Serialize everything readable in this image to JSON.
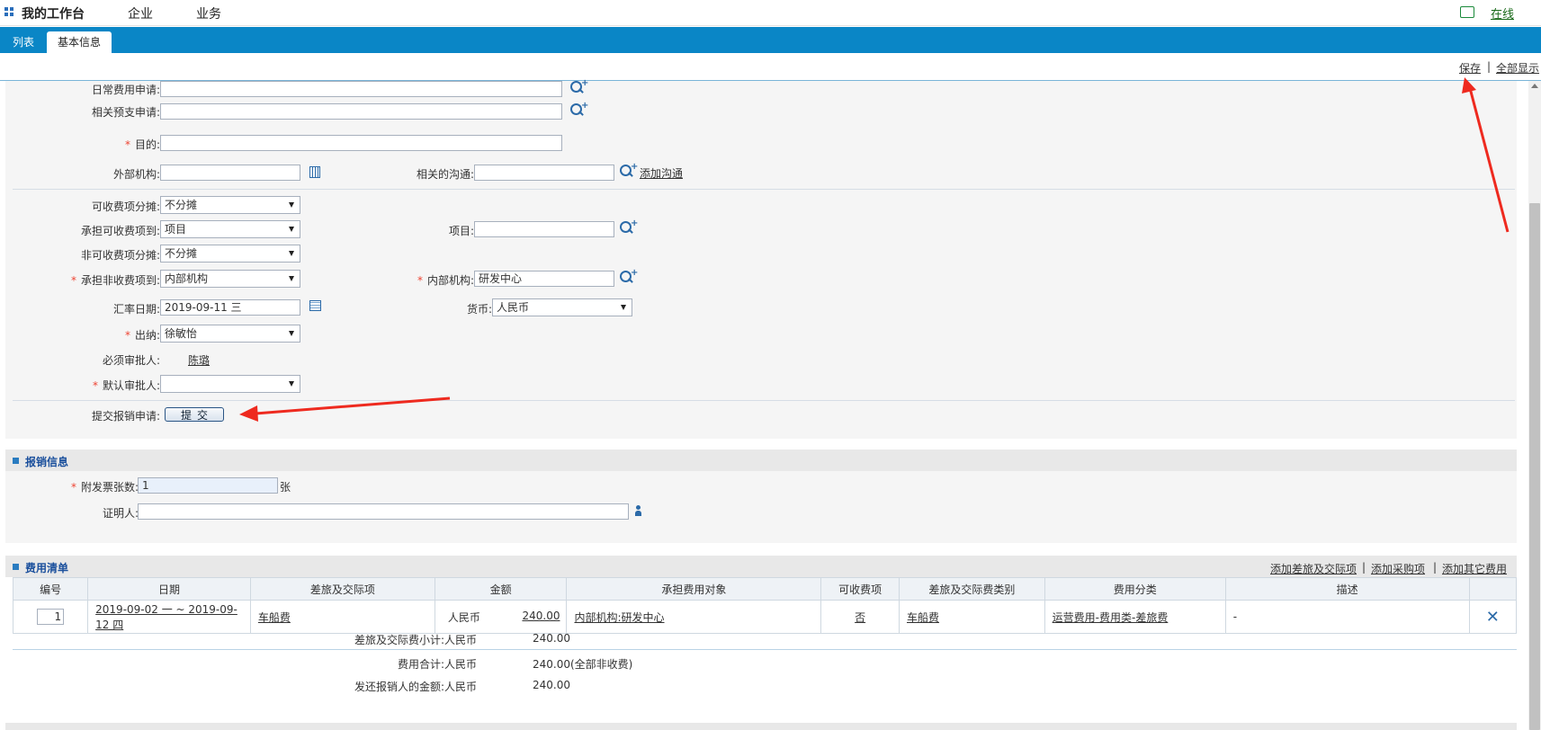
{
  "topbar": {
    "app_title": "我的工作台",
    "nav_items": [
      "企业",
      "业务"
    ],
    "online_label": "在线"
  },
  "tabs": [
    {
      "label": "列表",
      "active": false
    },
    {
      "label": "基本信息",
      "active": true
    }
  ],
  "actions": {
    "save_label": "保存",
    "show_all_label": "全部显示",
    "separator": "|"
  },
  "form": {
    "daily_expense_label": "日常费用申请:",
    "related_advance_label": "相关预支申请:",
    "purpose_label": "目的:",
    "external_org_label": "外部机构:",
    "related_comm_label": "相关的沟通:",
    "add_comm_label": "添加沟通",
    "chargeable_split_label": "可收费项分摊:",
    "chargeable_split_value": "不分摊",
    "bear_chargeable_label": "承担可收费项到:",
    "bear_chargeable_value": "项目",
    "project_label": "项目:",
    "non_chargeable_split_label": "非可收费项分摊:",
    "non_chargeable_split_value": "不分摊",
    "bear_non_chargeable_label": "承担非收费项到:",
    "bear_non_chargeable_value": "内部机构",
    "internal_org_label": "内部机构:",
    "internal_org_value": "研发中心",
    "rate_date_label": "汇率日期:",
    "rate_date_value": "2019-09-11 三",
    "currency_label": "货币:",
    "currency_value": "人民币",
    "cashier_label": "出纳:",
    "cashier_value": "徐敏怡",
    "required_approver_label": "必须审批人:",
    "required_approver_value": "陈璐",
    "default_approver_label": "默认审批人:",
    "default_approver_value": "",
    "submit_label": "提交报销申请:",
    "submit_button": "提交"
  },
  "reimbursement": {
    "section_title": "报销信息",
    "invoice_count_label": "附发票张数:",
    "invoice_count_value": "1",
    "invoice_unit": "张",
    "witness_label": "证明人:"
  },
  "expenses": {
    "section_title": "费用清单",
    "links": [
      "添加差旅及交际项",
      "添加采购项",
      "添加其它费用项"
    ],
    "link_separator": "|",
    "columns": [
      "编号",
      "日期",
      "差旅及交际项",
      "金额",
      "承担费用对象",
      "可收费项",
      "差旅及交际费类别",
      "费用分类",
      "描述"
    ],
    "rows": [
      {
        "no": "1",
        "date": "2019-09-02 一 ~ 2019-09-12 四",
        "item": "车船费",
        "currency": "人民币",
        "amount": "240.00",
        "bearer": "内部机构:研发中心",
        "chargeable": "否",
        "category": "车船费",
        "classification": "运营费用-费用类-差旅费",
        "description": "-"
      }
    ],
    "subtotal_label": "差旅及交际费小计:",
    "subtotal_currency": "人民币",
    "subtotal_value": "240.00",
    "total_label": "费用合计:",
    "total_currency": "人民币",
    "total_value": "240.00(全部非收费)",
    "payback_label": "发还报销人的金额:",
    "payback_currency": "人民币",
    "payback_value": "240.00"
  },
  "colors": {
    "tab_band": "#0a86c6",
    "accent_blue": "#1a4f9c",
    "required_star": "#ee4433",
    "annotation_arrow": "#ee2a1f"
  }
}
